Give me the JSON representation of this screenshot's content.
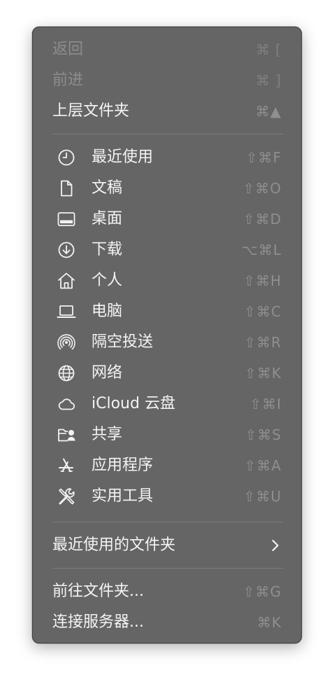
{
  "menu": {
    "back": {
      "label": "返回",
      "shortcut": "⌘ ["
    },
    "forward": {
      "label": "前进",
      "shortcut": "⌘ ]"
    },
    "enclosing_folder": {
      "label": "上层文件夹",
      "shortcut": "⌘▲"
    },
    "places": [
      {
        "label": "最近使用",
        "shortcut": "⇧⌘F",
        "icon": "clock-icon"
      },
      {
        "label": "文稿",
        "shortcut": "⇧⌘O",
        "icon": "document-icon"
      },
      {
        "label": "桌面",
        "shortcut": "⇧⌘D",
        "icon": "desktop-icon"
      },
      {
        "label": "下载",
        "shortcut": "⌥⌘L",
        "icon": "download-icon"
      },
      {
        "label": "个人",
        "shortcut": "⇧⌘H",
        "icon": "home-icon"
      },
      {
        "label": "电脑",
        "shortcut": "⇧⌘C",
        "icon": "laptop-icon"
      },
      {
        "label": "隔空投送",
        "shortcut": "⇧⌘R",
        "icon": "airdrop-icon"
      },
      {
        "label": "网络",
        "shortcut": "⇧⌘K",
        "icon": "globe-icon"
      },
      {
        "label": "iCloud 云盘",
        "shortcut": "⇧⌘I",
        "icon": "cloud-icon"
      },
      {
        "label": "共享",
        "shortcut": "⇧⌘S",
        "icon": "shared-folder-icon"
      },
      {
        "label": "应用程序",
        "shortcut": "⇧⌘A",
        "icon": "applications-icon"
      },
      {
        "label": "实用工具",
        "shortcut": "⇧⌘U",
        "icon": "utilities-icon"
      }
    ],
    "recent_folders": {
      "label": "最近使用的文件夹",
      "icon": "chevron-right-icon"
    },
    "go_to_folder": {
      "label": "前往文件夹...",
      "shortcut": "⇧⌘G"
    },
    "connect_server": {
      "label": "连接服务器...",
      "shortcut": "⌘K"
    }
  }
}
